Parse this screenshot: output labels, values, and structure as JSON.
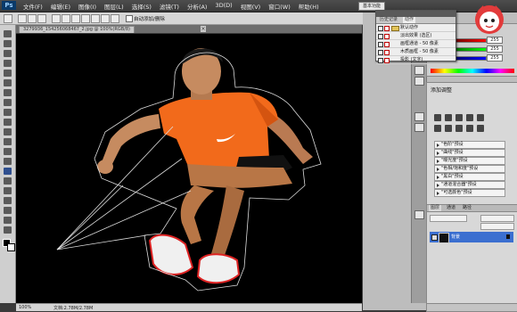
{
  "menubar": {
    "app_icon": "Ps",
    "menus": [
      "文件(F)",
      "编辑(E)",
      "图像(I)",
      "图层(L)",
      "选择(S)",
      "滤镜(T)",
      "分析(A)",
      "3D(D)",
      "视图(V)",
      "窗口(W)",
      "帮助(H)"
    ],
    "workspace_label": "基本功能"
  },
  "options_bar": {
    "auto_add_delete_label": "自动添加/删除"
  },
  "document": {
    "tab_title": "3279936_154256068467_2.jpg @ 100%(RGB/8)",
    "zoom": "100%",
    "doc_info": "文档:2.78M/2.78M"
  },
  "actions_panel": {
    "tabs": [
      "历史记录",
      "动作"
    ],
    "items": [
      {
        "label": "默认动作"
      },
      {
        "label": "淡出效果 (选区)"
      },
      {
        "label": "画框通道 - 50 像素"
      },
      {
        "label": "木质画框 - 50 像素"
      },
      {
        "label": "投影 (文字)"
      }
    ]
  },
  "color_panel": {
    "values": [
      "255",
      "255",
      "255"
    ]
  },
  "adjustments_panel": {
    "title": "添加调整",
    "presets": [
      "\"色阶\"预设",
      "\"曲线\"预设",
      "\"曝光度\"预设",
      "\"色相/饱和度\"预设",
      "\"黑白\"预设",
      "\"通道混合器\"预设",
      "\"可选颜色\"预设"
    ]
  },
  "layers_panel": {
    "tabs": [
      "图层",
      "通道",
      "路径"
    ],
    "layer_name": "背景"
  },
  "colors": {
    "canvas_bg": "#000000",
    "shirt_orange": "#f26a1b",
    "skin": "#c98a5e",
    "selected_layer": "#3b6fd0"
  }
}
